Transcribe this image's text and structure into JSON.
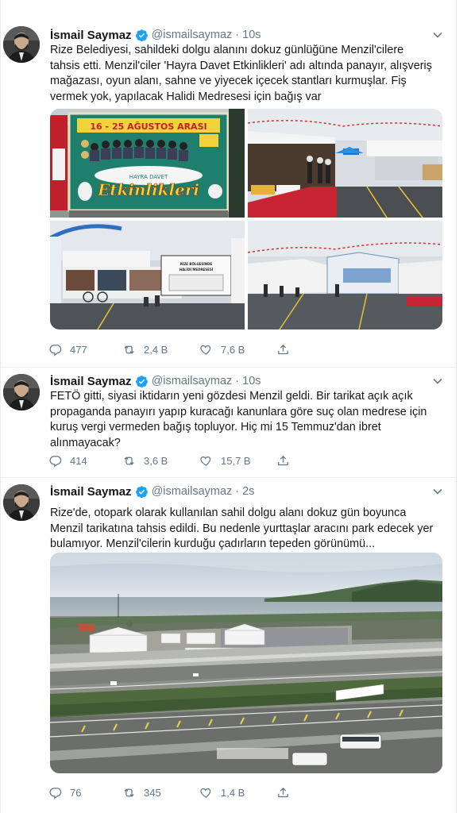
{
  "tweets": [
    {
      "name": "İsmail Saymaz",
      "handle": "@ismailsaymaz",
      "time": "10s",
      "text": "Rize Belediyesi, sahildeki dolgu alanını dokuz günlüğüne Menzil'cilere tahsis etti. Menzil'ciler 'Hayra Davet Etkinlikleri' adı altında panayır, alışveriş mağazası, oyun alanı, sahne ve yiyecek içecek stantları kurmuşlar. Fiş vermek yok, yapılacak Halidi Medresesi için bağış var",
      "replies": "477",
      "retweets": "2,4 B",
      "likes": "7,6 B",
      "banner_dates": "16 - 25 AĞUSTOS ARASI",
      "banner_sub": "HAYRA DAVET",
      "banner_main": "Etkinlikleri",
      "sign_text": "RİZE BÖLGESİNDE HALİDİ MEDRESESİ'NE İNŞA EDECEĞİMİZ TESİSLER"
    },
    {
      "name": "İsmail Saymaz",
      "handle": "@ismailsaymaz",
      "time": "10s",
      "text": "FETÖ gitti, siyasi iktidarın yeni gözdesi Menzil geldi. Bir tarikat açık açık propaganda panayırı yapıp kuracağı kanunlara göre suç olan medrese için kuruş vergi vermeden bağış topluyor. Hiç mi 15 Temmuz'dan ibret alınmayacak?",
      "replies": "414",
      "retweets": "3,6 B",
      "likes": "15,7 B"
    },
    {
      "name": "İsmail Saymaz",
      "handle": "@ismailsaymaz",
      "time": "2s",
      "text": "Rize'de, otopark olarak kullanılan sahil dolgu alanı dokuz gün boyunca Menzil tarikatına tahsis edildi. Bu nedenle yurttaşlar aracını park edecek yer bulamıyor. Menzil'cilerin kurduğu çadırların tepeden görünümü...",
      "replies": "76",
      "retweets": "345",
      "likes": "1,4 B"
    }
  ],
  "colors": {
    "verified": "#1da1f2",
    "text": "#14171a",
    "muted": "#657786",
    "border": "#e6ecf0"
  },
  "icons": [
    "verified-badge-icon",
    "chevron-down-icon",
    "reply-icon",
    "retweet-icon",
    "like-icon",
    "share-icon"
  ]
}
